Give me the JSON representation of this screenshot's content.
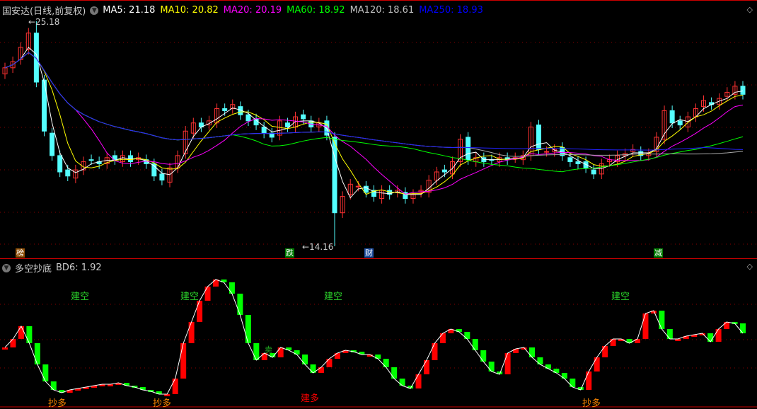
{
  "header": {
    "title": "国安达(日线,前复权)",
    "ma": [
      {
        "label": "MA5: 21.18",
        "color": "#ffffff"
      },
      {
        "label": "MA10: 20.82",
        "color": "#ffff00"
      },
      {
        "label": "MA20: 20.19",
        "color": "#ff00ff"
      },
      {
        "label": "MA60: 18.92",
        "color": "#00ff00"
      },
      {
        "label": "MA120: 18.61",
        "color": "#c0c0c0"
      },
      {
        "label": "MA250: 18.93",
        "color": "#0000ff"
      }
    ]
  },
  "price": {
    "high_label": "25.18",
    "low_label": "14.16",
    "high": 25.18,
    "low": 14.16,
    "closes": [
      22.9,
      23.2,
      23.9,
      24.6,
      22.2,
      19.8,
      18.6,
      17.8,
      17.6,
      17.9,
      18.3,
      18.4,
      18.2,
      18.5,
      18.4,
      18.6,
      18.3,
      18.5,
      18.2,
      17.6,
      17.4,
      18.0,
      18.6,
      19.8,
      20.2,
      20.0,
      20.3,
      20.9,
      20.8,
      21.1,
      20.6,
      20.3,
      20.1,
      19.7,
      19.5,
      20.3,
      20.0,
      20.5,
      20.4,
      20.0,
      20.2,
      19.6,
      15.8,
      16.6,
      17.2,
      17.1,
      16.8,
      16.6,
      16.9,
      16.7,
      16.9,
      16.5,
      16.7,
      16.9,
      17.4,
      17.8,
      17.8,
      18.3,
      19.4,
      18.4,
      18.5,
      18.3,
      18.4,
      18.5,
      18.4,
      18.5,
      18.6,
      20.0,
      18.9,
      18.8,
      18.9,
      18.6,
      18.3,
      18.2,
      18.0,
      17.7,
      18.2,
      18.4,
      18.6,
      18.7,
      18.9,
      18.6,
      18.7,
      19.5,
      20.8,
      20.2,
      20.1,
      20.5,
      20.9,
      21.3,
      21.1,
      21.4,
      21.7,
      22.0,
      21.6
    ],
    "markers": [
      {
        "text": "榜",
        "bg": "#8a4a00"
      },
      {
        "text": "跌",
        "bg": "#007a00"
      },
      {
        "text": "财",
        "bg": "#1f4fa0"
      },
      {
        "text": "减",
        "bg": "#007a00"
      }
    ]
  },
  "indicator": {
    "title": "多空抄底",
    "value_label": "BD6: 1.92",
    "values": [
      42,
      48,
      57,
      45,
      30,
      18,
      12,
      10,
      12,
      13,
      14,
      15,
      16,
      16,
      17,
      15,
      14,
      12,
      11,
      9,
      9,
      20,
      45,
      60,
      75,
      85,
      90,
      88,
      80,
      65,
      45,
      33,
      38,
      35,
      42,
      40,
      37,
      30,
      24,
      28,
      34,
      38,
      40,
      39,
      37,
      37,
      34,
      28,
      20,
      15,
      13,
      23,
      33,
      45,
      52,
      55,
      53,
      48,
      40,
      32,
      25,
      23,
      38,
      41,
      42,
      35,
      30,
      27,
      24,
      20,
      14,
      12,
      25,
      35,
      43,
      48,
      48,
      45,
      48,
      66,
      68,
      55,
      48,
      48,
      50,
      51,
      52,
      46,
      55,
      60,
      59,
      52
    ],
    "labels": {
      "short": "建空",
      "bottom_long": "抄多",
      "long": "建多",
      "sell": "卖"
    }
  }
}
